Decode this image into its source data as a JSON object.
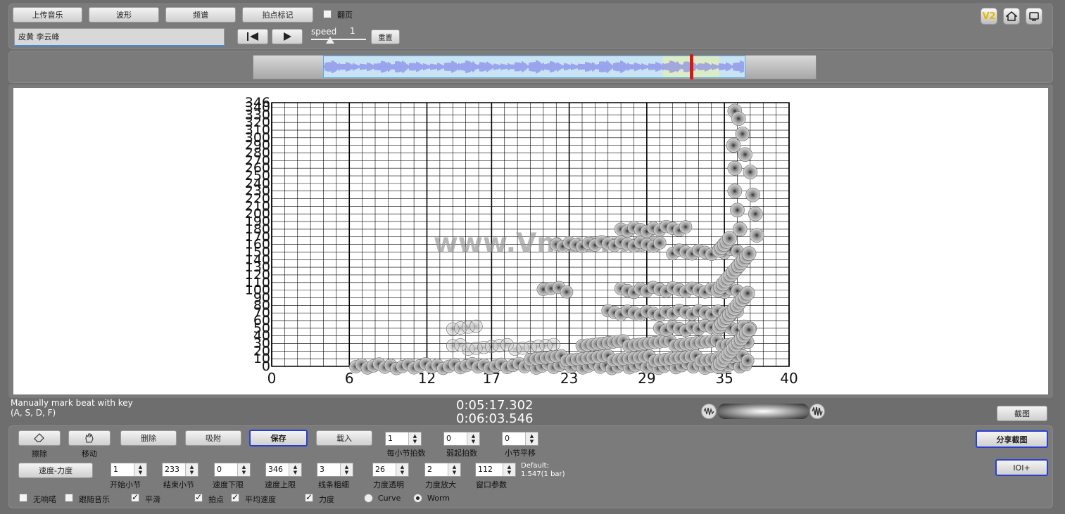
{
  "toolbar": {
    "upload_label": "上传音乐",
    "waveform_label": "波形",
    "spectrum_label": "频谱",
    "beat_mark_label": "拍点标记",
    "flip_page_label": "翻页",
    "song_title": "皮黄 李云峰",
    "speed_label": "speed",
    "speed_value": "1",
    "reset_label": "重置",
    "version_badge": "V2"
  },
  "chart_data": {
    "type": "scatter",
    "title": "",
    "xlabel": "",
    "ylabel": "",
    "xlim": [
      0,
      40
    ],
    "ylim": [
      0,
      346
    ],
    "x_ticks": [
      "0",
      "6",
      "12",
      "17",
      "23",
      "29",
      "35",
      "40"
    ],
    "y_ticks": [
      "0",
      "10",
      "20",
      "30",
      "40",
      "50",
      "60",
      "70",
      "80",
      "90",
      "100",
      "110",
      "120",
      "130",
      "140",
      "150",
      "160",
      "170",
      "180",
      "190",
      "200",
      "210",
      "220",
      "230",
      "240",
      "250",
      "260",
      "270",
      "280",
      "290",
      "300",
      "310",
      "320",
      "330",
      "340",
      "346"
    ],
    "grid": true,
    "watermark": "www.Vmus.net",
    "clusters": [
      {
        "x_from": 6.5,
        "x_to": 37,
        "y": 0,
        "step": 0.45
      },
      {
        "x_from": 20,
        "x_to": 37,
        "y": 10,
        "step": 0.4
      },
      {
        "x_from": 24,
        "x_to": 37,
        "y": 30,
        "step": 0.4
      },
      {
        "x_from": 14,
        "x_to": 22,
        "y": 25,
        "step": 0.6
      },
      {
        "x_from": 14,
        "x_to": 16,
        "y": 50,
        "step": 0.6
      },
      {
        "x_from": 30,
        "x_to": 37,
        "y": 50,
        "step": 0.5
      },
      {
        "x_from": 26,
        "x_to": 36,
        "y": 70,
        "step": 0.5
      },
      {
        "x_from": 27,
        "x_to": 36,
        "y": 100,
        "step": 0.5
      },
      {
        "x_from": 21,
        "x_to": 23,
        "y": 100,
        "step": 0.6
      },
      {
        "x_from": 22,
        "x_to": 30,
        "y": 160,
        "step": 0.5
      },
      {
        "x_from": 27,
        "x_to": 32,
        "y": 180,
        "step": 0.5
      },
      {
        "x_from": 31,
        "x_to": 36,
        "y": 150,
        "step": 0.5
      }
    ],
    "column": {
      "x_from": 34.5,
      "x_to": 37,
      "y_from": 0,
      "y_to": 170,
      "step": 4
    },
    "upper_points": [
      {
        "x": 35.8,
        "y": 335
      },
      {
        "x": 36.1,
        "y": 325
      },
      {
        "x": 36.4,
        "y": 305
      },
      {
        "x": 35.7,
        "y": 290
      },
      {
        "x": 36.6,
        "y": 278
      },
      {
        "x": 35.8,
        "y": 260
      },
      {
        "x": 37.0,
        "y": 255
      },
      {
        "x": 35.8,
        "y": 230
      },
      {
        "x": 37.2,
        "y": 225
      },
      {
        "x": 36.0,
        "y": 205
      },
      {
        "x": 37.4,
        "y": 200
      },
      {
        "x": 36.2,
        "y": 180
      },
      {
        "x": 37.5,
        "y": 172
      }
    ]
  },
  "status": {
    "hint_line1": "Manually mark beat with key",
    "hint_line2": "(A, S, D, F)",
    "current_time": "0:05:17.302",
    "total_time": "0:06:03.546",
    "screenshot_label": "截图"
  },
  "controls": {
    "erase_label": "擦除",
    "move_label": "移动",
    "delete_label": "删除",
    "snap_label": "吸附",
    "save_label": "保存",
    "load_label": "载入",
    "share_label": "分享截图",
    "ioi_label": "IOI+",
    "tempo_dynamics_label": "速度-力度",
    "default_line1": "Default:",
    "default_line2": "1.547(1 bar)",
    "fields_row1": [
      {
        "value": "1",
        "label": "每小节拍数"
      },
      {
        "value": "0",
        "label": "弱起拍数"
      },
      {
        "value": "0",
        "label": "小节平移"
      }
    ],
    "fields_row2": [
      {
        "value": "1",
        "label": "开始小节"
      },
      {
        "value": "233",
        "label": "结束小节"
      },
      {
        "value": "0",
        "label": "速度下限"
      },
      {
        "value": "346",
        "label": "速度上限"
      },
      {
        "value": "3",
        "label": "线条粗细"
      },
      {
        "value": "26",
        "label": "力度透明"
      },
      {
        "value": "2",
        "label": "力度放大"
      },
      {
        "value": "112",
        "label": "窗口参数"
      }
    ],
    "options": [
      {
        "label": "无响喏"
      },
      {
        "label": "跟随音乐"
      },
      {
        "label": "平滑"
      },
      {
        "label": "拍点"
      },
      {
        "label": "平均速度"
      },
      {
        "label": "力度"
      }
    ],
    "mode_curve": "Curve",
    "mode_worm": "Worm"
  },
  "colors": {
    "accent": "#2b3fcf",
    "waveform": "#7b7be8",
    "playhead": "#d81818"
  }
}
